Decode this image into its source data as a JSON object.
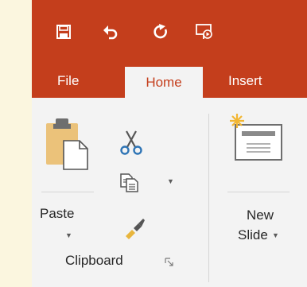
{
  "colors": {
    "accent": "#C43E1C",
    "ribbon_bg": "#F3F3F3",
    "page_bg": "#FBF6DF"
  },
  "quick_access": {
    "items": [
      {
        "icon": "save-icon"
      },
      {
        "icon": "undo-icon"
      },
      {
        "icon": "redo-icon"
      },
      {
        "icon": "slideshow-icon"
      }
    ]
  },
  "tabs": [
    {
      "label": "File"
    },
    {
      "label": "Home",
      "active": true
    },
    {
      "label": "Insert"
    }
  ],
  "clipboard": {
    "paste_label": "Paste",
    "group_label": "Clipboard",
    "tools": [
      {
        "icon": "cut-icon"
      },
      {
        "icon": "copy-icon"
      },
      {
        "icon": "format-painter-icon"
      }
    ]
  },
  "slides": {
    "new_slide_label_line1": "New",
    "new_slide_label_line2": "Slide"
  }
}
